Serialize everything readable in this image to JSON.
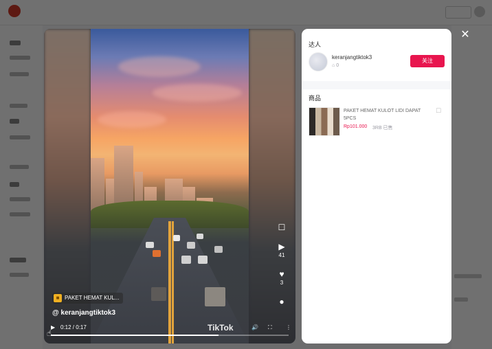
{
  "video": {
    "product_tag": "PAKET HEMAT KUL...",
    "handle": "@ keranjangtiktok3",
    "like_count": "41",
    "share_count": "3",
    "time": "0:12 / 0:17",
    "progress": 0.706,
    "watermark": "TikTok",
    "icons": [
      "bookmark-icon",
      "play-icon",
      "heart-icon",
      "comment-icon",
      "play-icon",
      "volume-icon",
      "fullscreen-icon",
      "more-icon"
    ]
  },
  "panel": {
    "creator_section_title": "达人",
    "creator_name": "keranjangtiktok3",
    "creator_stat": "0",
    "follow_label": "关注",
    "products_section_title": "商品",
    "product": {
      "title": "PAKET HEMAT KULOT LIDI DAPAT 5PCS",
      "price": "Rp101.000",
      "sold": "3RB 已售"
    }
  },
  "colors": {
    "accent": "#e8154e",
    "overlay": "rgba(0,0,0,0.56)"
  }
}
